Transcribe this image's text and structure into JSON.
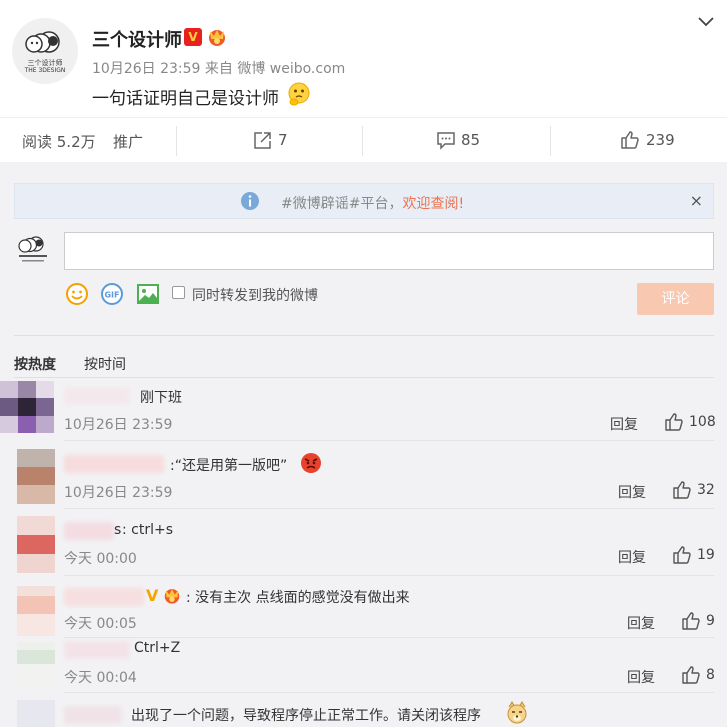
{
  "post": {
    "author": "三个设计师",
    "verified_badge": "V",
    "logo_text_cn": "三个设计师",
    "logo_text_en": "THE 3DESIGN",
    "meta": "10月26日 23:59 来自 微博 weibo.com",
    "text": "一句话证明自己是设计师",
    "emoji": "thinking-emoji"
  },
  "actions": {
    "reads": "阅读 5.2万",
    "promote": "推广",
    "reposts": "7",
    "comments": "85",
    "likes": "239"
  },
  "notice": {
    "text": "#微博辟谣#平台，",
    "link": "欢迎查阅!",
    "close": "×"
  },
  "composer": {
    "input_value": "",
    "repost_label": "同时转发到我的微博",
    "submit": "评论",
    "gif_label": "GIF"
  },
  "sort": {
    "hot": "按热度",
    "time": "按时间"
  },
  "comments": [
    {
      "text": "刚下班",
      "time": "10月26日 23:59",
      "reply": "回复",
      "likes": "108"
    },
    {
      "text": ":“还是用第一版吧”",
      "time": "10月26日 23:59",
      "reply": "回复",
      "likes": "32"
    },
    {
      "name_suffix": "s",
      "text": ": ctrl+s",
      "time": "今天 00:00",
      "reply": "回复",
      "likes": "19"
    },
    {
      "badge": "V",
      "text": ": 没有主次 点线面的感觉没有做出来",
      "time": "今天 00:05",
      "reply": "回复",
      "likes": "9"
    },
    {
      "text": "Ctrl+Z",
      "time": "今天 00:04",
      "reply": "回复",
      "likes": "8"
    },
    {
      "text": "出现了一个问题，导致程序停止正常工作。请关闭该程序"
    }
  ],
  "colors": {
    "accent": "#eb7350",
    "verified": "#e8211e",
    "background": "#f2f2f5"
  }
}
